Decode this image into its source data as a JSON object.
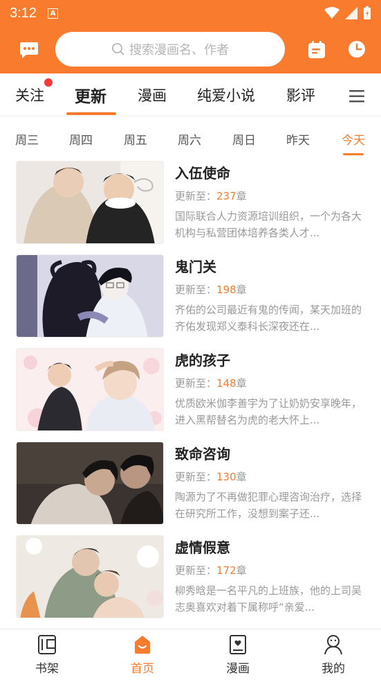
{
  "status": {
    "time": "3:12",
    "notif": "A"
  },
  "search": {
    "placeholder": "搜索漫画名、作者"
  },
  "tabs": [
    {
      "label": "关注"
    },
    {
      "label": "更新"
    },
    {
      "label": "漫画"
    },
    {
      "label": "纯爱小说"
    },
    {
      "label": "影评"
    }
  ],
  "days": [
    "周三",
    "周四",
    "周五",
    "周六",
    "周日",
    "昨天",
    "今天"
  ],
  "update_prefix": "更新至：",
  "update_suffix": "章",
  "comics": [
    {
      "title": "入伍使命",
      "chapter": "237",
      "desc": "国际联合人力资源培训组织，一个为各大机构与私营团体培养各类人才..."
    },
    {
      "title": "鬼门关",
      "chapter": "198",
      "desc": "齐佑的公司最近有鬼的传闻，某天加班的齐佑发现郑义泰科长深夜还在..."
    },
    {
      "title": "虎的孩子",
      "chapter": "148",
      "desc": "优质欧米伽李善宇为了让奶奶安享晚年，进入黑帮替名为虎的老大怀上..."
    },
    {
      "title": "致命咨询",
      "chapter": "130",
      "desc": "陶源为了不再做犯罪心理咨询治疗，选择在研究所工作，没想到案子还..."
    },
    {
      "title": "虚情假意",
      "chapter": "172",
      "desc": "柳秀晗是一名平凡的上班族，他的上司吴志奥喜欢对着下属称呼“亲爱..."
    }
  ],
  "nav": [
    {
      "label": "书架"
    },
    {
      "label": "首页"
    },
    {
      "label": "漫画"
    },
    {
      "label": "我的"
    }
  ],
  "colors": {
    "accent": "#f97b2e",
    "badge": "#f43a3a"
  }
}
